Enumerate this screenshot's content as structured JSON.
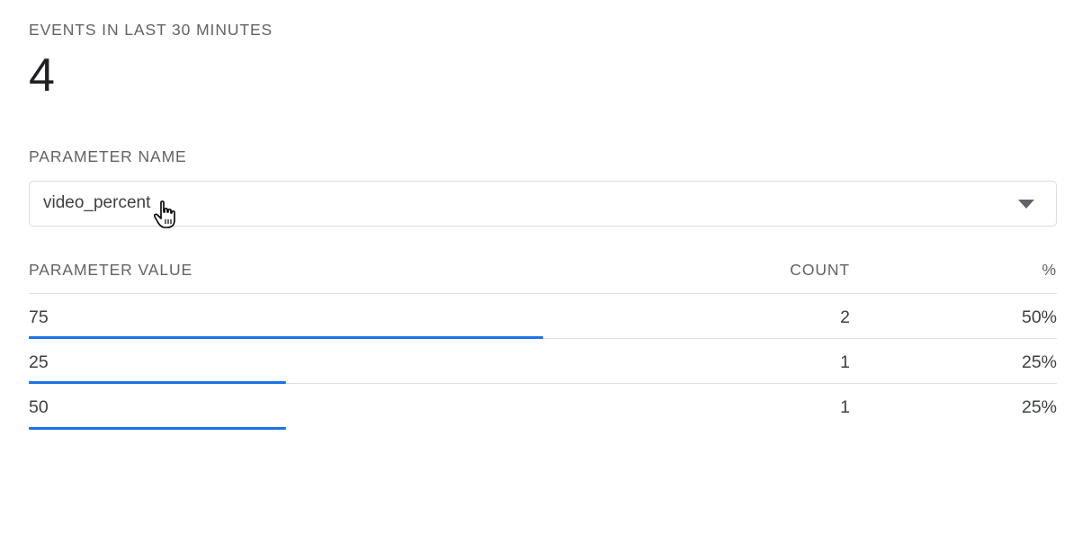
{
  "events": {
    "label": "EVENTS IN LAST 30 MINUTES",
    "count": "4"
  },
  "parameter": {
    "label": "PARAMETER NAME",
    "selected": "video_percent"
  },
  "table": {
    "headers": {
      "value": "PARAMETER VALUE",
      "count": "COUNT",
      "percent": "%"
    },
    "rows": [
      {
        "value": "75",
        "count": "2",
        "percent": "50%",
        "share": 0.5
      },
      {
        "value": "25",
        "count": "1",
        "percent": "25%",
        "share": 0.25
      },
      {
        "value": "50",
        "count": "1",
        "percent": "25%",
        "share": 0.25
      }
    ]
  },
  "colors": {
    "bar": "#1a73e8",
    "label": "#5f6368",
    "border": "#dadce0"
  },
  "icons": {
    "dropdown": "caret-down-icon",
    "cursor": "hand-pointer-cursor-icon"
  }
}
